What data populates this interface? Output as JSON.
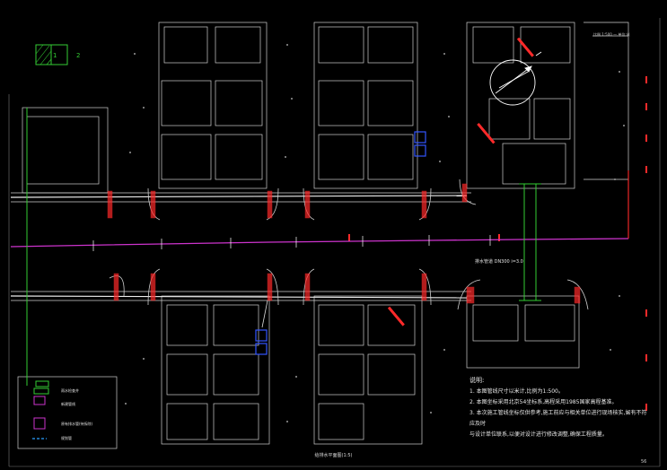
{
  "drawing": {
    "title_bottom": "给排水平面图(1:5)",
    "page_number": "56",
    "scale_note": "比例 1:500 — 单位:米",
    "pipe_label": "排水管道 DN300 i=3.0"
  },
  "block_labels": [
    "1",
    "2"
  ],
  "notes": {
    "heading": "说明:",
    "items": [
      "1. 本图管线尺寸以米计,比例为1:500。",
      "2. 本图坐标采用北京54坐标系,高程采用1985国家高程基准。",
      "3. 本次施工管线坐标仅供参考,施工前应与相关单位进行现场核实,如有不符应及时",
      "   与设计单位联系,以便对设计进行修改调整,确保工程质量。"
    ]
  },
  "legend": {
    "items": [
      "雨水检查井",
      "新建管线",
      "原有排水管(待拆除)",
      "规划管"
    ]
  },
  "colors": {
    "background": "#000000",
    "building": "#d0d0d0",
    "pipe_main": "#cc33cc",
    "pipe_green": "#33cc33",
    "red_marks": "#ff2a2a",
    "blue_marks": "#2a2aff"
  }
}
